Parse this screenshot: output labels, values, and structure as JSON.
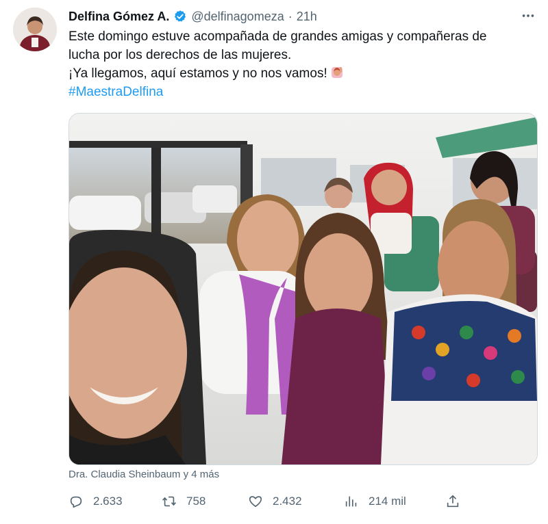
{
  "tweet": {
    "author_name": "Delfina Gómez A.",
    "handle": "@delfinagomeza",
    "separator": "·",
    "time": "21h",
    "text_lines": [
      "Este domingo estuve acompañada de grandes amigas y compañeras de",
      "lucha por los derechos de las mujeres.",
      "¡Ya llegamos, aquí estamos y no nos vamos!"
    ],
    "hashtag": "#MaestraDelfina",
    "tagged": "Dra. Claudia Sheinbaum y 4 más"
  },
  "actions": {
    "replies": "2.633",
    "retweets": "758",
    "likes": "2.432",
    "views": "214 mil"
  },
  "icons": {
    "more": "more-icon",
    "verified": "verified-badge-icon",
    "reply": "reply-icon",
    "retweet": "retweet-icon",
    "like": "heart-icon",
    "views": "views-icon",
    "share": "share-icon",
    "emoji": "woman-raising-hand-emoji"
  },
  "colors": {
    "accent": "#1d9bf0",
    "secondary_text": "#536471",
    "primary_text": "#0f1419"
  }
}
